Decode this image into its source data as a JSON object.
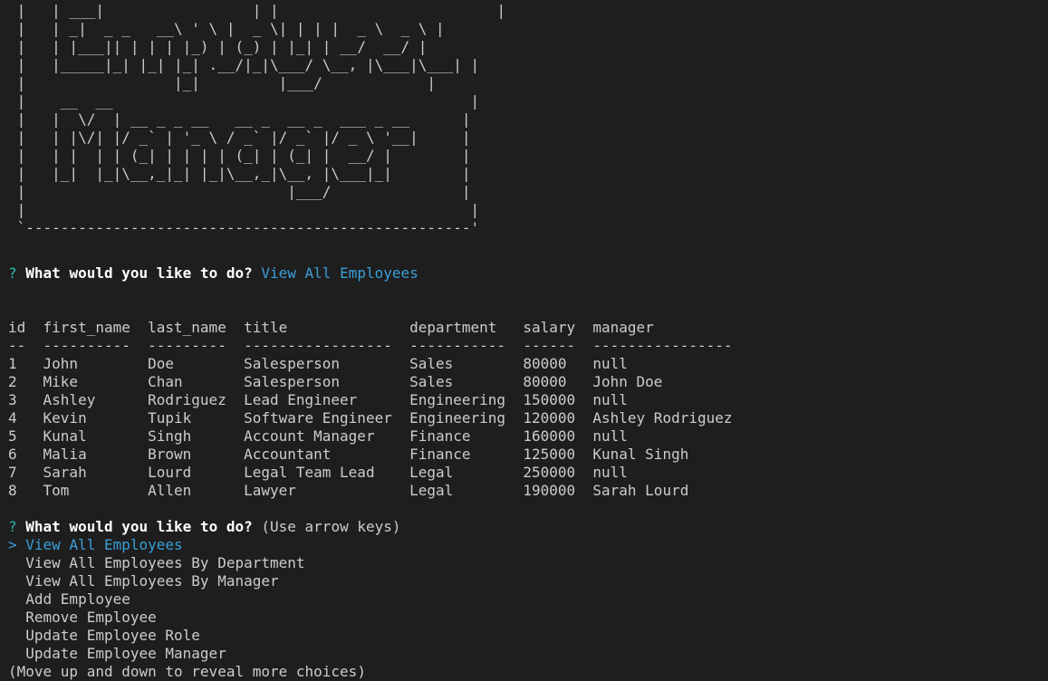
{
  "banner": {
    "ascii_art": " |   | ___|                 | |                         |\n |   | _|  _ _   __\\ ' \\ |  _ \\| | | |  _ \\  _ \\ |\n |   | |___|| | | | |_) | (_) | |_| | __/  __/ |\n |   |_____|_| |_| |_| .__/|_|\\___/ \\__, |\\___|\\___| |\n |                 |_|         |___/            |\n |    __  __                                         |\n |   |  \\/  | __ _ _ __   __ _  __ _  ___ _ __      |\n |   | |\\/| |/ _` | '_ \\ / _` |/ _` |/ _ \\ '__|     |\n |   | |  | | (_| | | | | (_| | (_| |  __/ |        |\n |   |_|  |_|\\__,_|_| |_|\\__,_|\\__, |\\___|_|        |\n |                              |___/               |\n |                                                   |\n `---------------------------------------------------'"
  },
  "prompt1": {
    "mark": "?",
    "question": "What would you like to do?",
    "answer": "View All Employees"
  },
  "table": {
    "headers": [
      "id",
      "first_name",
      "last_name",
      "title",
      "department",
      "salary",
      "manager"
    ],
    "dividers": [
      "--",
      "----------",
      "---------",
      "-----------------",
      "-----------",
      "------",
      "----------------"
    ],
    "rows": [
      [
        "1",
        "John",
        "Doe",
        "Salesperson",
        "Sales",
        "80000",
        "null"
      ],
      [
        "2",
        "Mike",
        "Chan",
        "Salesperson",
        "Sales",
        "80000",
        "John Doe"
      ],
      [
        "3",
        "Ashley",
        "Rodriguez",
        "Lead Engineer",
        "Engineering",
        "150000",
        "null"
      ],
      [
        "4",
        "Kevin",
        "Tupik",
        "Software Engineer",
        "Engineering",
        "120000",
        "Ashley Rodriguez"
      ],
      [
        "5",
        "Kunal",
        "Singh",
        "Account Manager",
        "Finance",
        "160000",
        "null"
      ],
      [
        "6",
        "Malia",
        "Brown",
        "Accountant",
        "Finance",
        "125000",
        "Kunal Singh"
      ],
      [
        "7",
        "Sarah",
        "Lourd",
        "Legal Team Lead",
        "Legal",
        "250000",
        "null"
      ],
      [
        "8",
        "Tom",
        "Allen",
        "Lawyer",
        "Legal",
        "190000",
        "Sarah Lourd"
      ]
    ]
  },
  "prompt2": {
    "mark": "?",
    "question": "What would you like to do?",
    "hint": "(Use arrow keys)",
    "pointer": ">",
    "choices": [
      "View All Employees",
      "View All Employees By Department",
      "View All Employees By Manager",
      "Add Employee",
      "Remove Employee",
      "Update Employee Role",
      "Update Employee Manager"
    ],
    "footer": "(Move up and down to reveal more choices)"
  },
  "colors": {
    "background": "#1e1e1e",
    "text": "#cccccc",
    "question": "#ffffff",
    "answer": "#3a9ed8",
    "question_mark": "#29b8b0"
  }
}
